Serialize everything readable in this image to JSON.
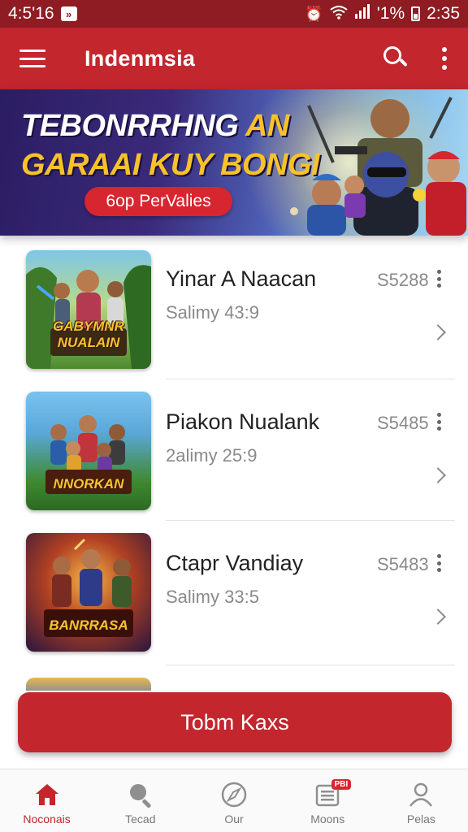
{
  "status_bar": {
    "time_left": "4:5'16",
    "notification_glyph": "»",
    "signal_text": "'1%",
    "time_right": "2:35"
  },
  "app_bar": {
    "title": "Indenmsia",
    "icons": [
      "menu-icon",
      "search-icon",
      "more-vert-icon"
    ]
  },
  "banner": {
    "headline_line1_main": "TEBONRRHNG ",
    "headline_line1_accent": "AN",
    "headline_line2": "GARAAI KUY BONGI",
    "button_label": "6op PerValies"
  },
  "games": [
    {
      "name": "Yinar A Naacan",
      "subtitle": "Salimy 43:9",
      "code": "S5288",
      "thumb_text": "GABYMNR NUALAIN"
    },
    {
      "name": "Piakon Nualank",
      "subtitle": "2alimy 25:9",
      "code": "S5485",
      "thumb_text": "NNORKAN"
    },
    {
      "name": "Ctapr Vandiay",
      "subtitle": "Salimy 33:5",
      "code": "S5483",
      "thumb_text": "BANRRASA"
    }
  ],
  "cta": {
    "label": "Tobm Kaxs"
  },
  "bottom_nav": {
    "items": [
      {
        "label": "Noconais",
        "icon": "home-icon",
        "active": true
      },
      {
        "label": "Tecad",
        "icon": "search-icon",
        "active": false
      },
      {
        "label": "Our",
        "icon": "compass-icon",
        "active": false
      },
      {
        "label": "Moons",
        "icon": "list-icon",
        "active": false,
        "badge": "PBI"
      },
      {
        "label": "Pelas",
        "icon": "person-icon",
        "active": false
      }
    ]
  },
  "colors": {
    "primary": "#c3262d",
    "status_bar": "#8e1c22",
    "banner_accent": "#f8c22a"
  }
}
